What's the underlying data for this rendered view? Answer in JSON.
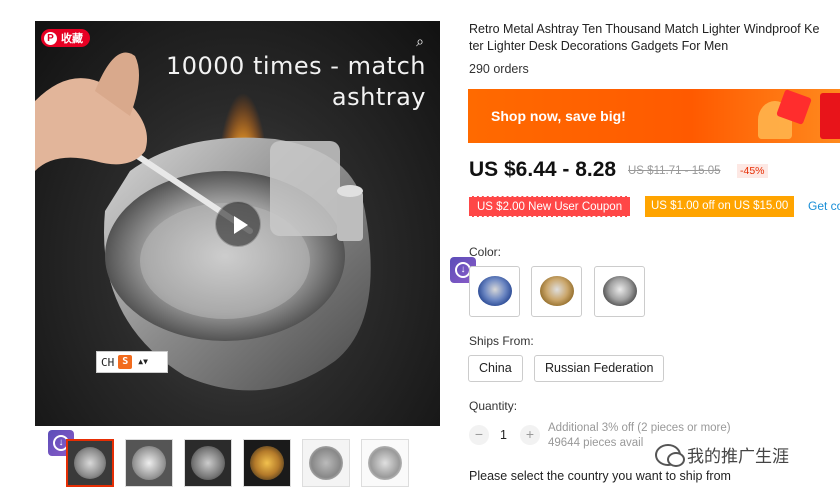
{
  "media": {
    "overlay_line1": "10000 times - match",
    "overlay_line2": "ashtray",
    "pin_label": "收藏",
    "pin_icon": "pinterest-icon",
    "zoom_icon": "zoom-icon",
    "play_icon": "play-icon",
    "ime": {
      "mode": "CH",
      "logo": "S",
      "logo_icon": "sogou-logo-icon",
      "arrows": "▲▼"
    },
    "thumbnails_count": 6
  },
  "product": {
    "title_line1": "Retro Metal Ashtray Ten Thousand Match Lighter Windproof Ke",
    "title_line2": "ter Lighter Desk Decorations Gadgets For Men",
    "orders": "290 orders"
  },
  "banner": {
    "text": "Shop now, save big!"
  },
  "price": {
    "current": "US $6.44 - 8.28",
    "original": "US $11.71 - 15.05",
    "discount": "-45%"
  },
  "coupons": {
    "new_user": "US $2.00 New User Coupon",
    "store": "US $1.00 off on US $15.00",
    "get_link": "Get co"
  },
  "color": {
    "label": "Color:",
    "options": [
      "blue",
      "gold",
      "silver"
    ]
  },
  "shipping": {
    "label": "Ships From:",
    "options": [
      "China",
      "Russian Federation"
    ]
  },
  "quantity": {
    "label": "Quantity:",
    "value": "1",
    "minus": "−",
    "plus": "+",
    "note_line1": "Additional 3% off (2 pieces or more)",
    "note_line2": "49644 pieces avail"
  },
  "ship_note": "Please select the country you want to ship from",
  "watermark": {
    "text": "我的推广生涯",
    "icon": "wechat-icon"
  },
  "colors": {
    "accent": "#ff6a00",
    "price_red": "#e62e04",
    "coupon_red": "#ff4747",
    "coupon_orange": "#ffa400",
    "link": "#1a8fd7"
  }
}
